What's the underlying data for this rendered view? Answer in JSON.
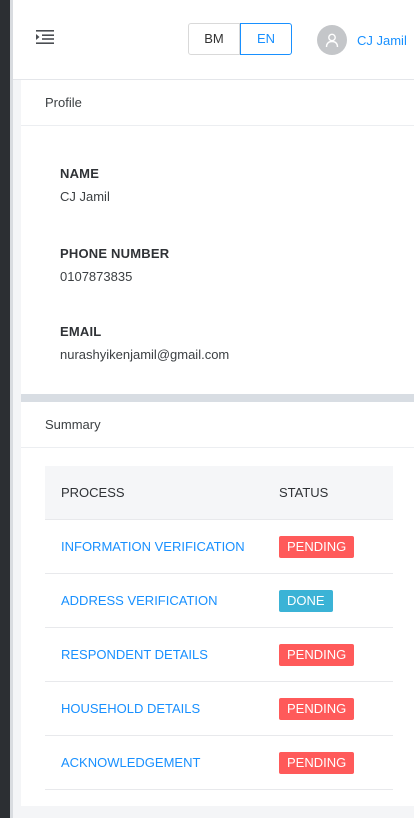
{
  "header": {
    "lang_bm": "BM",
    "lang_en": "EN",
    "user_name": "CJ Jamil"
  },
  "profile": {
    "title": "Profile",
    "name_label": "NAME",
    "name_value": "CJ Jamil",
    "phone_label": "PHONE NUMBER",
    "phone_value": "0107873835",
    "email_label": "EMAIL",
    "email_value": "nurashyikenjamil@gmail.com"
  },
  "summary": {
    "title": "Summary",
    "col_process": "PROCESS",
    "col_status": "STATUS",
    "rows": [
      {
        "process": "INFORMATION VERIFICATION",
        "status": "PENDING"
      },
      {
        "process": "ADDRESS VERIFICATION",
        "status": "DONE"
      },
      {
        "process": "RESPONDENT DETAILS",
        "status": "PENDING"
      },
      {
        "process": "HOUSEHOLD DETAILS",
        "status": "PENDING"
      },
      {
        "process": "ACKNOWLEDGEMENT",
        "status": "PENDING"
      }
    ]
  },
  "colors": {
    "accent": "#1890ff",
    "pending": "#ff5a5a",
    "done": "#3bb3d6"
  },
  "icons": {
    "menu": "menu-unfold-icon",
    "avatar": "user-icon"
  }
}
